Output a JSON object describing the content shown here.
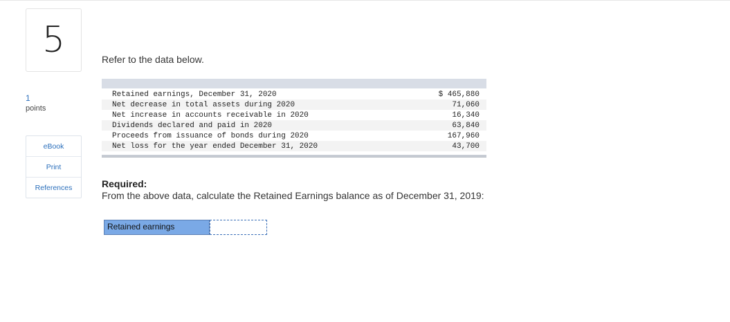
{
  "question": {
    "number": "5",
    "points_value": "1",
    "points_label": "points"
  },
  "sidebar": {
    "links": [
      {
        "label": "eBook"
      },
      {
        "label": "Print"
      },
      {
        "label": "References"
      }
    ]
  },
  "content": {
    "intro": "Refer to the data below.",
    "table": {
      "rows": [
        {
          "label": "Retained earnings, December 31, 2020",
          "value": "$ 465,880"
        },
        {
          "label": "Net decrease in total assets during 2020",
          "value": "71,060"
        },
        {
          "label": "Net increase in accounts receivable in 2020",
          "value": "16,340"
        },
        {
          "label": "Dividends declared and paid in 2020",
          "value": "63,840"
        },
        {
          "label": "Proceeds from issuance of bonds during 2020",
          "value": "167,960"
        },
        {
          "label": "Net loss for the year ended December 31, 2020",
          "value": "43,700"
        }
      ]
    },
    "required_title": "Required:",
    "required_text": "From the above data, calculate the Retained Earnings balance as of December 31, 2019:",
    "answer": {
      "label": "Retained earnings",
      "value": ""
    }
  },
  "colors": {
    "link": "#2a6ebb",
    "answer_label_bg": "#7aa9e6",
    "table_header_bg": "#d8dde6"
  }
}
